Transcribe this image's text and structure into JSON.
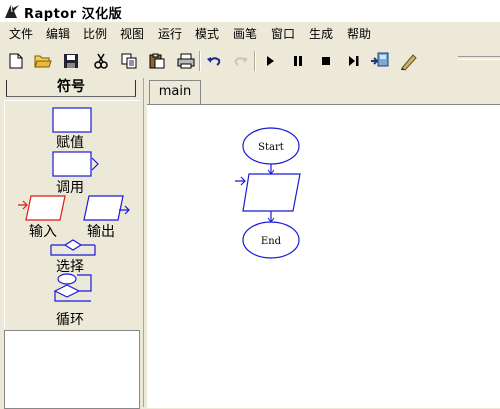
{
  "window": {
    "title": "Raptor 汉化版"
  },
  "menu": [
    "文件",
    "编辑",
    "比例",
    "视图",
    "运行",
    "模式",
    "画笔",
    "窗口",
    "生成",
    "帮助"
  ],
  "toolbar": {
    "icons": [
      "new-file-icon",
      "open-folder-icon",
      "save-icon",
      "cut-icon",
      "copy-icon",
      "paste-icon",
      "print-icon",
      "undo-icon",
      "redo-icon",
      "run-icon",
      "pause-icon",
      "stop-icon",
      "step-icon",
      "test-server-icon",
      "pen-icon"
    ]
  },
  "symbols_panel": {
    "header": "符号",
    "items": {
      "assign": "赋值",
      "call": "调用",
      "input": "输入",
      "output": "输出",
      "selection": "选择",
      "loop": "循环"
    }
  },
  "tabs": [
    {
      "label": "main"
    }
  ],
  "flowchart": {
    "start_label": "Start",
    "end_label": "End"
  },
  "colors": {
    "shape_stroke": "#1a1ad8",
    "input_highlight": "#e01818"
  }
}
